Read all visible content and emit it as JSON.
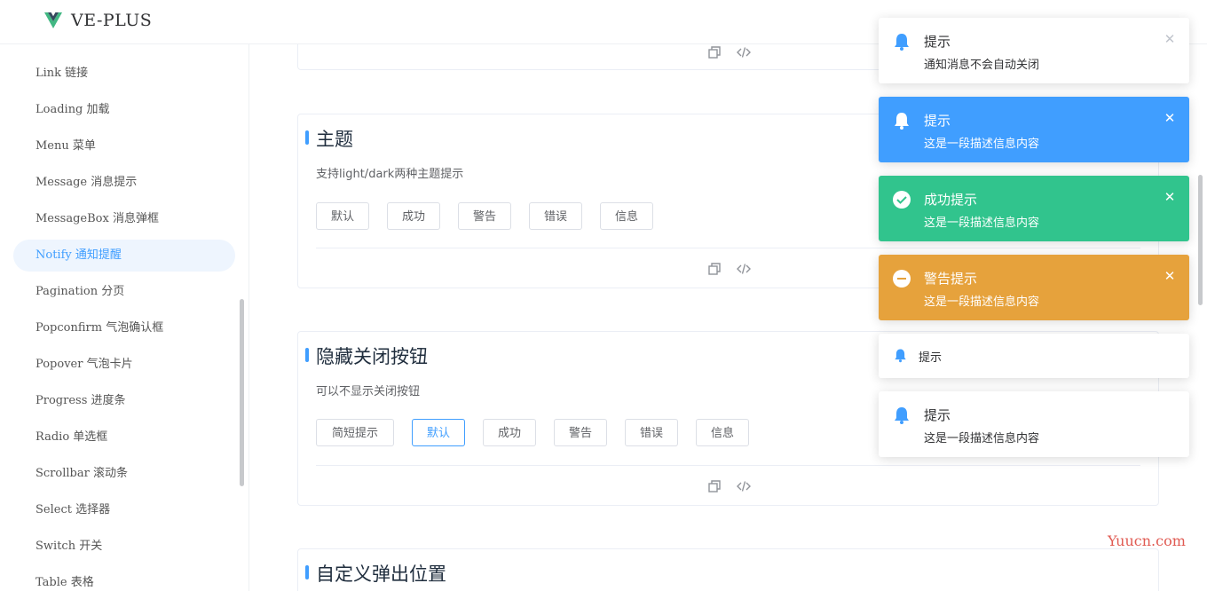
{
  "header": {
    "brand": "VE-PLUS"
  },
  "sidebar": {
    "items": [
      {
        "label": "Link 链接",
        "active": false
      },
      {
        "label": "Loading 加载",
        "active": false
      },
      {
        "label": "Menu 菜单",
        "active": false
      },
      {
        "label": "Message 消息提示",
        "active": false
      },
      {
        "label": "MessageBox 消息弹框",
        "active": false
      },
      {
        "label": "Notify 通知提醒",
        "active": true
      },
      {
        "label": "Pagination 分页",
        "active": false
      },
      {
        "label": "Popconfirm 气泡确认框",
        "active": false
      },
      {
        "label": "Popover 气泡卡片",
        "active": false
      },
      {
        "label": "Progress 进度条",
        "active": false
      },
      {
        "label": "Radio 单选框",
        "active": false
      },
      {
        "label": "Scrollbar 滚动条",
        "active": false
      },
      {
        "label": "Select 选择器",
        "active": false
      },
      {
        "label": "Switch 开关",
        "active": false
      },
      {
        "label": "Table 表格",
        "active": false
      }
    ]
  },
  "sections": {
    "theme": {
      "title": "主题",
      "desc": "支持light/dark两种主题提示",
      "buttons": [
        "默认",
        "成功",
        "警告",
        "错误",
        "信息"
      ]
    },
    "hide_close": {
      "title": "隐藏关闭按钮",
      "desc": "可以不显示关闭按钮",
      "buttons": [
        "简短提示",
        "默认",
        "成功",
        "警告",
        "错误",
        "信息"
      ]
    },
    "position": {
      "title": "自定义弹出位置"
    }
  },
  "toolbar_icons": [
    "copy-icon",
    "code-icon"
  ],
  "notifications": [
    {
      "title": "提示",
      "message": "通知消息不会自动关闭",
      "variant": "white",
      "icon": "bell-icon",
      "closable": true
    },
    {
      "title": "提示",
      "message": "这是一段描述信息内容",
      "variant": "blue",
      "icon": "bell-icon",
      "closable": true
    },
    {
      "title": "成功提示",
      "message": "这是一段描述信息内容",
      "variant": "green",
      "icon": "check-circle-icon",
      "closable": true
    },
    {
      "title": "警告提示",
      "message": "这是一段描述信息内容",
      "variant": "orange",
      "icon": "minus-circle-icon",
      "closable": true
    },
    {
      "title": "提示",
      "message": "",
      "variant": "white",
      "icon": "bell-icon",
      "closable": false
    },
    {
      "title": "提示",
      "message": "这是一段描述信息内容",
      "variant": "white",
      "icon": "bell-icon",
      "closable": false
    }
  ],
  "colors": {
    "primary": "#409eff",
    "success": "#31c48d",
    "warning": "#e6a23c"
  },
  "watermark": "Yuucn.com",
  "close_glyph": "✕"
}
